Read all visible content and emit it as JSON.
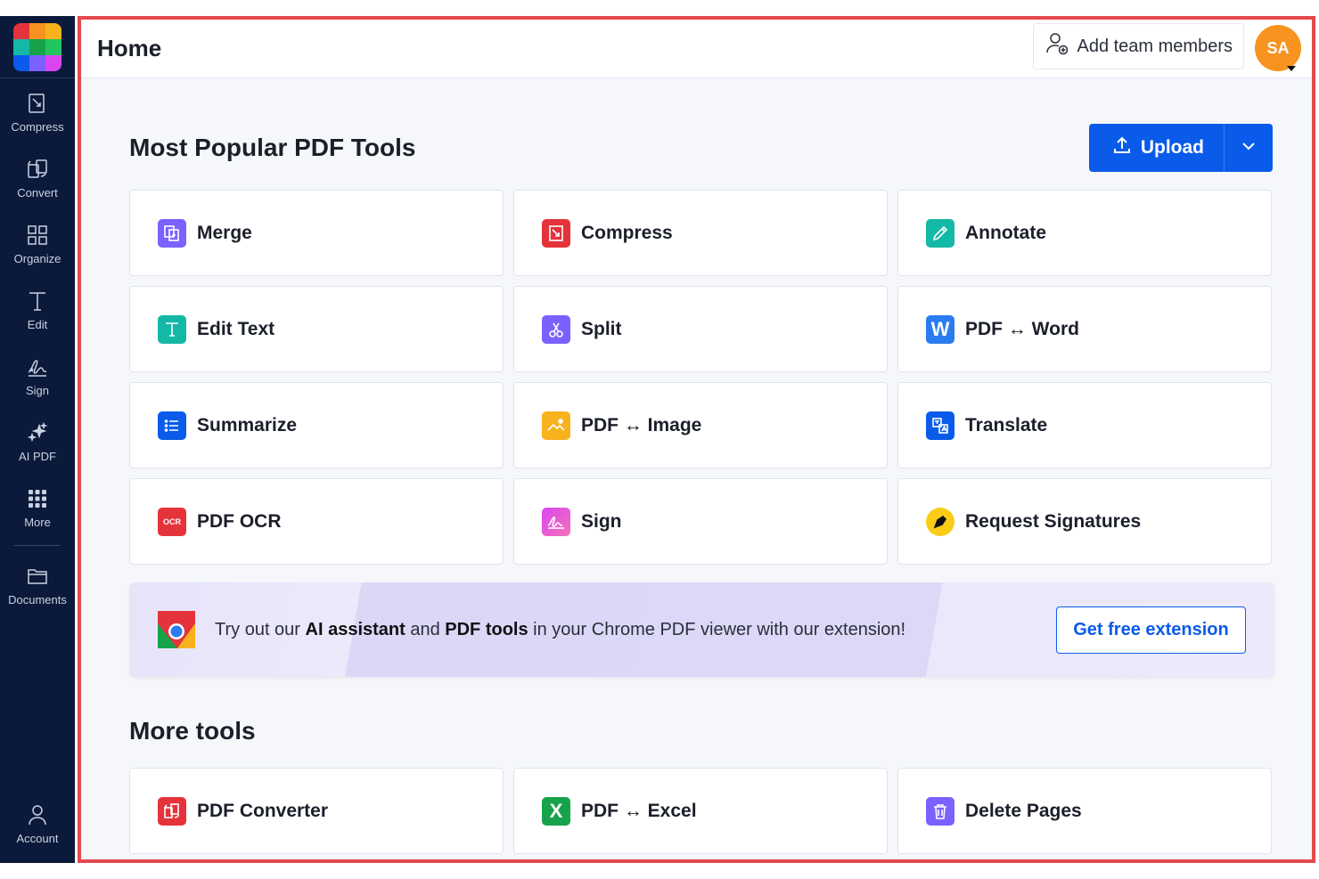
{
  "sidebar": {
    "items": [
      {
        "label": "Compress",
        "icon": "compress-icon"
      },
      {
        "label": "Convert",
        "icon": "convert-icon"
      },
      {
        "label": "Organize",
        "icon": "organize-icon"
      },
      {
        "label": "Edit",
        "icon": "edit-text-icon"
      },
      {
        "label": "Sign",
        "icon": "signature-icon"
      },
      {
        "label": "AI PDF",
        "icon": "sparkle-icon"
      },
      {
        "label": "More",
        "icon": "grid-dots-icon"
      },
      {
        "label": "Documents",
        "icon": "folder-icon"
      }
    ],
    "account": {
      "label": "Account",
      "icon": "user-icon"
    }
  },
  "header": {
    "title": "Home",
    "add_team_label": "Add team members",
    "avatar_initials": "SA"
  },
  "popular": {
    "title": "Most Popular PDF Tools",
    "upload_label": "Upload",
    "tools": [
      {
        "label": "Merge",
        "color": "#7b61ff",
        "icon": "merge-icon"
      },
      {
        "label": "Compress",
        "color": "#e5333b",
        "icon": "compress-icon"
      },
      {
        "label": "Annotate",
        "color": "#14b8a6",
        "icon": "pencil-icon"
      },
      {
        "label": "Edit Text",
        "color": "#14b8a6",
        "icon": "text-icon"
      },
      {
        "label": "Split",
        "color": "#7b61ff",
        "icon": "scissors-icon"
      },
      {
        "label": "PDF ↔ Word",
        "color": "#2b7cf0",
        "icon": "word-icon"
      },
      {
        "label": "Summarize",
        "color": "#0a5bea",
        "icon": "list-icon"
      },
      {
        "label": "PDF ↔ Image",
        "color": "#f7b21e",
        "icon": "image-icon"
      },
      {
        "label": "Translate",
        "color": "#0a5bea",
        "icon": "translate-icon"
      },
      {
        "label": "PDF OCR",
        "color": "#e5333b",
        "icon": "ocr-icon"
      },
      {
        "label": "Sign",
        "color": "#d946ef",
        "icon": "signature-icon"
      },
      {
        "label": "Request Signatures",
        "color": "#facc15",
        "icon": "pen-nib-icon"
      }
    ]
  },
  "banner": {
    "text_1": "Try out our ",
    "text_bold_1": "AI assistant",
    "text_2": " and ",
    "text_bold_2": "PDF tools",
    "text_3": " in your Chrome PDF viewer with our extension!",
    "button_label": "Get free extension"
  },
  "more_tools": {
    "title": "More tools",
    "tools": [
      {
        "label": "PDF Converter",
        "color": "#e5333b",
        "icon": "converter-icon"
      },
      {
        "label": "PDF ↔ Excel",
        "color": "#16a34a",
        "icon": "excel-icon"
      },
      {
        "label": "Delete Pages",
        "color": "#7b61ff",
        "icon": "trash-icon"
      }
    ]
  },
  "icon_text": {
    "word": "W",
    "excel": "X",
    "ocr": "OCR"
  }
}
